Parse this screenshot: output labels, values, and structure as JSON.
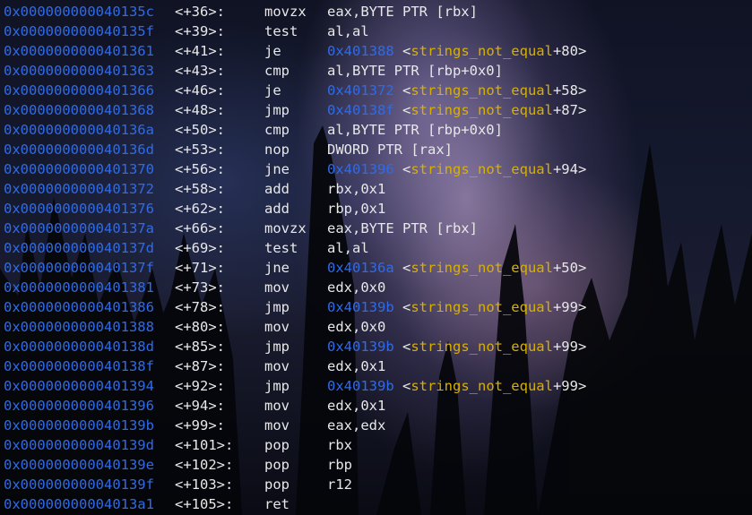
{
  "lines": [
    {
      "addr": "0x000000000040135c",
      "offset": "<+36>:",
      "mnemonic": "movzx",
      "args": "eax,BYTE PTR [rbx]",
      "target": "",
      "symbol": "",
      "sym_offset": ""
    },
    {
      "addr": "0x000000000040135f",
      "offset": "<+39>:",
      "mnemonic": "test",
      "args": "al,al",
      "target": "",
      "symbol": "",
      "sym_offset": ""
    },
    {
      "addr": "0x0000000000401361",
      "offset": "<+41>:",
      "mnemonic": "je",
      "args": "",
      "target": "0x401388",
      "symbol": "strings_not_equal",
      "sym_offset": "+80"
    },
    {
      "addr": "0x0000000000401363",
      "offset": "<+43>:",
      "mnemonic": "cmp",
      "args": "al,BYTE PTR [rbp+0x0]",
      "target": "",
      "symbol": "",
      "sym_offset": ""
    },
    {
      "addr": "0x0000000000401366",
      "offset": "<+46>:",
      "mnemonic": "je",
      "args": "",
      "target": "0x401372",
      "symbol": "strings_not_equal",
      "sym_offset": "+58"
    },
    {
      "addr": "0x0000000000401368",
      "offset": "<+48>:",
      "mnemonic": "jmp",
      "args": "",
      "target": "0x40138f",
      "symbol": "strings_not_equal",
      "sym_offset": "+87"
    },
    {
      "addr": "0x000000000040136a",
      "offset": "<+50>:",
      "mnemonic": "cmp",
      "args": "al,BYTE PTR [rbp+0x0]",
      "target": "",
      "symbol": "",
      "sym_offset": ""
    },
    {
      "addr": "0x000000000040136d",
      "offset": "<+53>:",
      "mnemonic": "nop",
      "args": "DWORD PTR [rax]",
      "target": "",
      "symbol": "",
      "sym_offset": ""
    },
    {
      "addr": "0x0000000000401370",
      "offset": "<+56>:",
      "mnemonic": "jne",
      "args": "",
      "target": "0x401396",
      "symbol": "strings_not_equal",
      "sym_offset": "+94"
    },
    {
      "addr": "0x0000000000401372",
      "offset": "<+58>:",
      "mnemonic": "add",
      "args": "rbx,0x1",
      "target": "",
      "symbol": "",
      "sym_offset": ""
    },
    {
      "addr": "0x0000000000401376",
      "offset": "<+62>:",
      "mnemonic": "add",
      "args": "rbp,0x1",
      "target": "",
      "symbol": "",
      "sym_offset": ""
    },
    {
      "addr": "0x000000000040137a",
      "offset": "<+66>:",
      "mnemonic": "movzx",
      "args": "eax,BYTE PTR [rbx]",
      "target": "",
      "symbol": "",
      "sym_offset": ""
    },
    {
      "addr": "0x000000000040137d",
      "offset": "<+69>:",
      "mnemonic": "test",
      "args": "al,al",
      "target": "",
      "symbol": "",
      "sym_offset": ""
    },
    {
      "addr": "0x000000000040137f",
      "offset": "<+71>:",
      "mnemonic": "jne",
      "args": "",
      "target": "0x40136a",
      "symbol": "strings_not_equal",
      "sym_offset": "+50"
    },
    {
      "addr": "0x0000000000401381",
      "offset": "<+73>:",
      "mnemonic": "mov",
      "args": "edx,0x0",
      "target": "",
      "symbol": "",
      "sym_offset": ""
    },
    {
      "addr": "0x0000000000401386",
      "offset": "<+78>:",
      "mnemonic": "jmp",
      "args": "",
      "target": "0x40139b",
      "symbol": "strings_not_equal",
      "sym_offset": "+99"
    },
    {
      "addr": "0x0000000000401388",
      "offset": "<+80>:",
      "mnemonic": "mov",
      "args": "edx,0x0",
      "target": "",
      "symbol": "",
      "sym_offset": ""
    },
    {
      "addr": "0x000000000040138d",
      "offset": "<+85>:",
      "mnemonic": "jmp",
      "args": "",
      "target": "0x40139b",
      "symbol": "strings_not_equal",
      "sym_offset": "+99"
    },
    {
      "addr": "0x000000000040138f",
      "offset": "<+87>:",
      "mnemonic": "mov",
      "args": "edx,0x1",
      "target": "",
      "symbol": "",
      "sym_offset": ""
    },
    {
      "addr": "0x0000000000401394",
      "offset": "<+92>:",
      "mnemonic": "jmp",
      "args": "",
      "target": "0x40139b",
      "symbol": "strings_not_equal",
      "sym_offset": "+99"
    },
    {
      "addr": "0x0000000000401396",
      "offset": "<+94>:",
      "mnemonic": "mov",
      "args": "edx,0x1",
      "target": "",
      "symbol": "",
      "sym_offset": ""
    },
    {
      "addr": "0x000000000040139b",
      "offset": "<+99>:",
      "mnemonic": "mov",
      "args": "eax,edx",
      "target": "",
      "symbol": "",
      "sym_offset": ""
    },
    {
      "addr": "0x000000000040139d",
      "offset": "<+101>:",
      "mnemonic": "pop",
      "args": "rbx",
      "target": "",
      "symbol": "",
      "sym_offset": ""
    },
    {
      "addr": "0x000000000040139e",
      "offset": "<+102>:",
      "mnemonic": "pop",
      "args": "rbp",
      "target": "",
      "symbol": "",
      "sym_offset": ""
    },
    {
      "addr": "0x000000000040139f",
      "offset": "<+103>:",
      "mnemonic": "pop",
      "args": "r12",
      "target": "",
      "symbol": "",
      "sym_offset": ""
    },
    {
      "addr": "0x00000000004013a1",
      "offset": "<+105>:",
      "mnemonic": "ret",
      "args": "",
      "target": "",
      "symbol": "",
      "sym_offset": ""
    }
  ]
}
